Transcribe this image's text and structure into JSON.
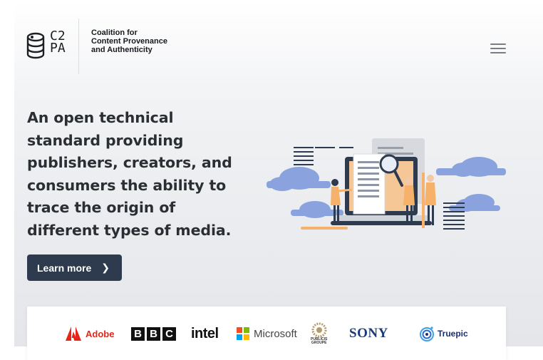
{
  "header": {
    "logo_line1": "C2",
    "logo_line2": "PA",
    "org_name_lines": [
      "Coalition for",
      "Content Provenance",
      "and Authenticity"
    ]
  },
  "hero": {
    "headline_lines": [
      "An open technical",
      "standard providing",
      "publishers, creators, and",
      "consumers the ability to",
      "trace the origin of",
      "different types of media."
    ],
    "cta_label": "Learn more",
    "cta_icon": "chevron-right-icon"
  },
  "partners": {
    "adobe": "Adobe",
    "bbc": [
      "B",
      "B",
      "C"
    ],
    "intel": "intel",
    "microsoft": "Microsoft",
    "publicis_lines": [
      "PUBLICIS",
      "GROUPE"
    ],
    "sony": "SONY",
    "truepic": "Truepic"
  },
  "colors": {
    "cta_bg": "#2e3a4e",
    "accent_blue": "#7f97d8",
    "accent_orange": "#f6b26b",
    "adobe_red": "#e5251a",
    "sony_blue": "#183a7a"
  }
}
